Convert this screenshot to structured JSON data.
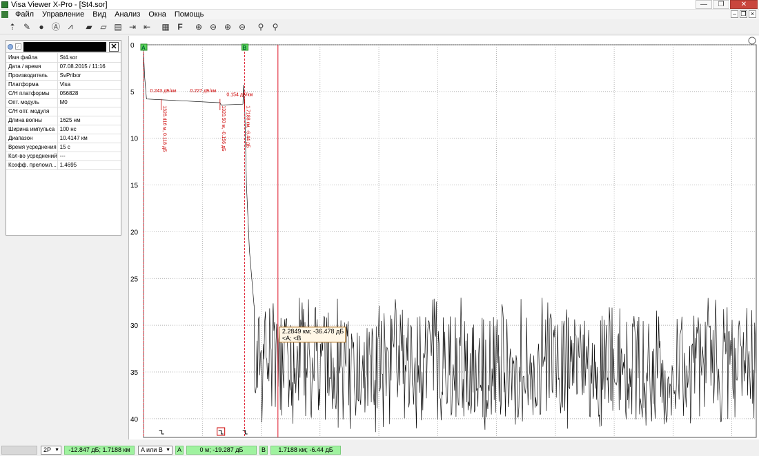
{
  "window": {
    "title": "Visa Viewer X-Pro - [St4.sor]",
    "min": "—",
    "max": "❐",
    "close": "✕"
  },
  "menu": [
    "Файл",
    "Управление",
    "Вид",
    "Анализ",
    "Окна",
    "Помощь"
  ],
  "toolbar_icons": [
    "pointer-icon",
    "wrench-icon",
    "play-icon",
    "analysis-icon",
    "trace-icon",
    "open-folder-icon",
    "open-file-icon",
    "save-icon",
    "export-icon",
    "import-icon",
    "grid-icon",
    "font-icon",
    "zoom-in-icon",
    "zoom-out-icon",
    "zoom-fit-icon",
    "zoom-reset-icon",
    "search-icon",
    "search-alt-icon"
  ],
  "file_panel": {
    "rows": [
      {
        "k": "Имя файла",
        "v": "St4.sor"
      },
      {
        "k": "Дата / время",
        "v": "07.08.2015 / 11:16"
      },
      {
        "k": "Производитель",
        "v": "SvPribor"
      },
      {
        "k": "Платформа",
        "v": "Visa"
      },
      {
        "k": "С/Н платформы",
        "v": "056828"
      },
      {
        "k": "Опт. модуль",
        "v": "M0"
      },
      {
        "k": "С/Н опт. модуля",
        "v": ""
      },
      {
        "k": "Длина волны",
        "v": "1625 нм"
      },
      {
        "k": "Ширина импульса",
        "v": "100 нс"
      },
      {
        "k": "Диапазон",
        "v": "10.4147 км"
      },
      {
        "k": "Время усреднения",
        "v": "15 с"
      },
      {
        "k": "Кол-во усреднений",
        "v": "---"
      },
      {
        "k": "Коэфф. преломл...",
        "v": "1.4695"
      }
    ]
  },
  "chart_data": {
    "type": "line",
    "x_range": [
      0,
      10.4147
    ],
    "y_range": [
      0,
      42
    ],
    "y_inverted": true,
    "x_ticks": [
      "0",
      "1",
      "2",
      "3",
      "4",
      "5",
      "6",
      "7",
      "8",
      "9",
      "10"
    ],
    "y_ticks": [
      "0",
      "5",
      "10",
      "15",
      "20",
      "25",
      "30",
      "35",
      "40"
    ],
    "grid": true,
    "markers": [
      {
        "label": "A",
        "x": 0.0
      },
      {
        "label": "B",
        "x": 1.7188
      }
    ],
    "cursor_x": 2.2849,
    "segment_labels": [
      "0.243 дБ/км",
      "0.227 дБ/км",
      "0.154 дБ/км"
    ],
    "event_labels": [
      "1326.416 м, 0.118 дБ",
      "1320.50 м, -0.156 дБ",
      "1.7188 км, -6.44 дБ"
    ],
    "trace": {
      "points": [
        [
          0,
          0.8
        ],
        [
          0.02,
          3.5
        ],
        [
          0.05,
          5.8
        ],
        [
          1.3,
          6.2
        ],
        [
          1.32,
          6.45
        ],
        [
          1.69,
          6.35
        ],
        [
          1.7,
          4.3
        ],
        [
          1.72,
          6.9
        ],
        [
          1.75,
          15
        ],
        [
          1.8,
          22
        ],
        [
          1.88,
          28
        ]
      ],
      "noise_start": 1.88,
      "noise_mean_y": 34.5,
      "noise_range": [
        27,
        41.5
      ]
    },
    "tooltip": [
      "2.2849 км; -36.478 дБ",
      "<A; <B"
    ]
  },
  "status": {
    "mode": "2P",
    "cursor_value": "-12.847 дБ; 1.7188 км",
    "selector": "A или B",
    "tag_a": "A",
    "a_value": "0 м; -19.287 дБ",
    "tag_b": "B",
    "b_value": "1.7188 км; -6.44 дБ"
  }
}
